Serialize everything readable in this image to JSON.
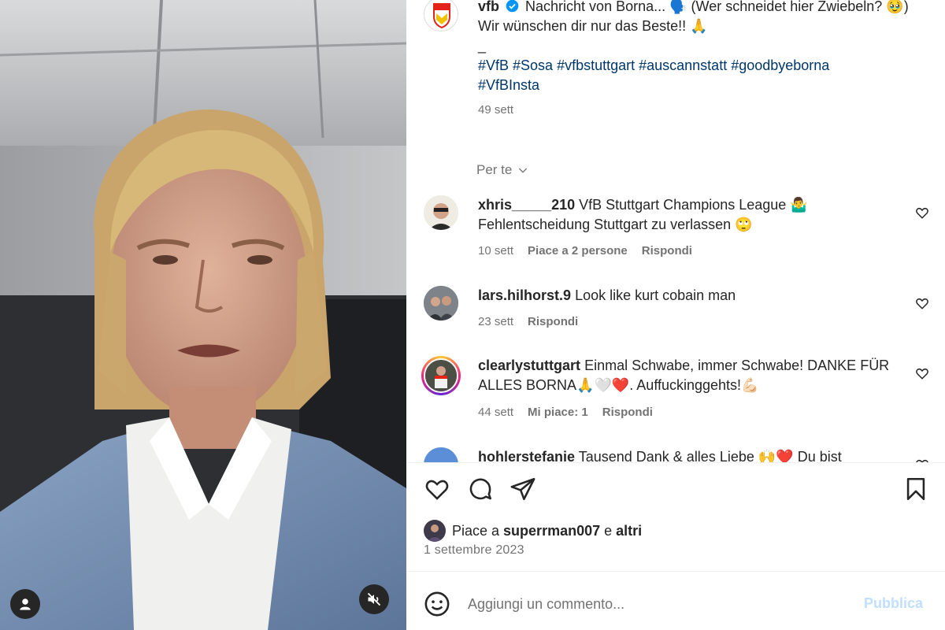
{
  "post": {
    "username": "vfb",
    "caption_line1": "Nachricht von Borna... 🗣️ (Wer schneidet hier Zwiebeln? 🥹)",
    "caption_line2": "Wir wünschen dir nur das Beste!! 🙏",
    "caption_sep": "_",
    "hashtags_line1": "#VfB #Sosa #vfbstuttgart #auscannstatt #goodbyeborna",
    "hashtags_line2": "#VfBInsta",
    "time": "49 sett",
    "verified_icon": "verified-badge-icon"
  },
  "filter": {
    "label": "Per te"
  },
  "comments": [
    {
      "username": "xhris_____210",
      "text": "VfB Stuttgart Champions League 🤷‍♂️ Fehlentscheidung Stuttgart zu verlassen 🙄",
      "time": "10 sett",
      "likes": "Piace a 2 persone",
      "reply": "Rispondi"
    },
    {
      "username": "lars.hilhorst.9",
      "text": "Look like kurt cobain man",
      "time": "23 sett",
      "reply": "Rispondi"
    },
    {
      "username": "clearlystuttgart",
      "text": "Einmal Schwabe, immer Schwabe! DANKE FÜR ALLES BORNA🙏🤍❤️. Auffuckinggehts!💪🏻",
      "time": "44 sett",
      "likes": "Mi piace: 1",
      "reply": "Rispondi"
    },
    {
      "username": "hohlerstefanie",
      "text": "Tausend Dank & alles Liebe 🙌❤️ Du bist"
    }
  ],
  "likes": {
    "prefix": "Piace a ",
    "user": "superrman007",
    "middle": " e ",
    "others": "altri"
  },
  "date": "1 settembre 2023",
  "comment_box": {
    "placeholder": "Aggiungi un commento...",
    "publish": "Pubblica"
  },
  "colors": {
    "link_blue": "#00376b",
    "verified_blue": "#0095f6",
    "publish_disabled": "#c0dffd",
    "meta_gray": "#737373"
  }
}
